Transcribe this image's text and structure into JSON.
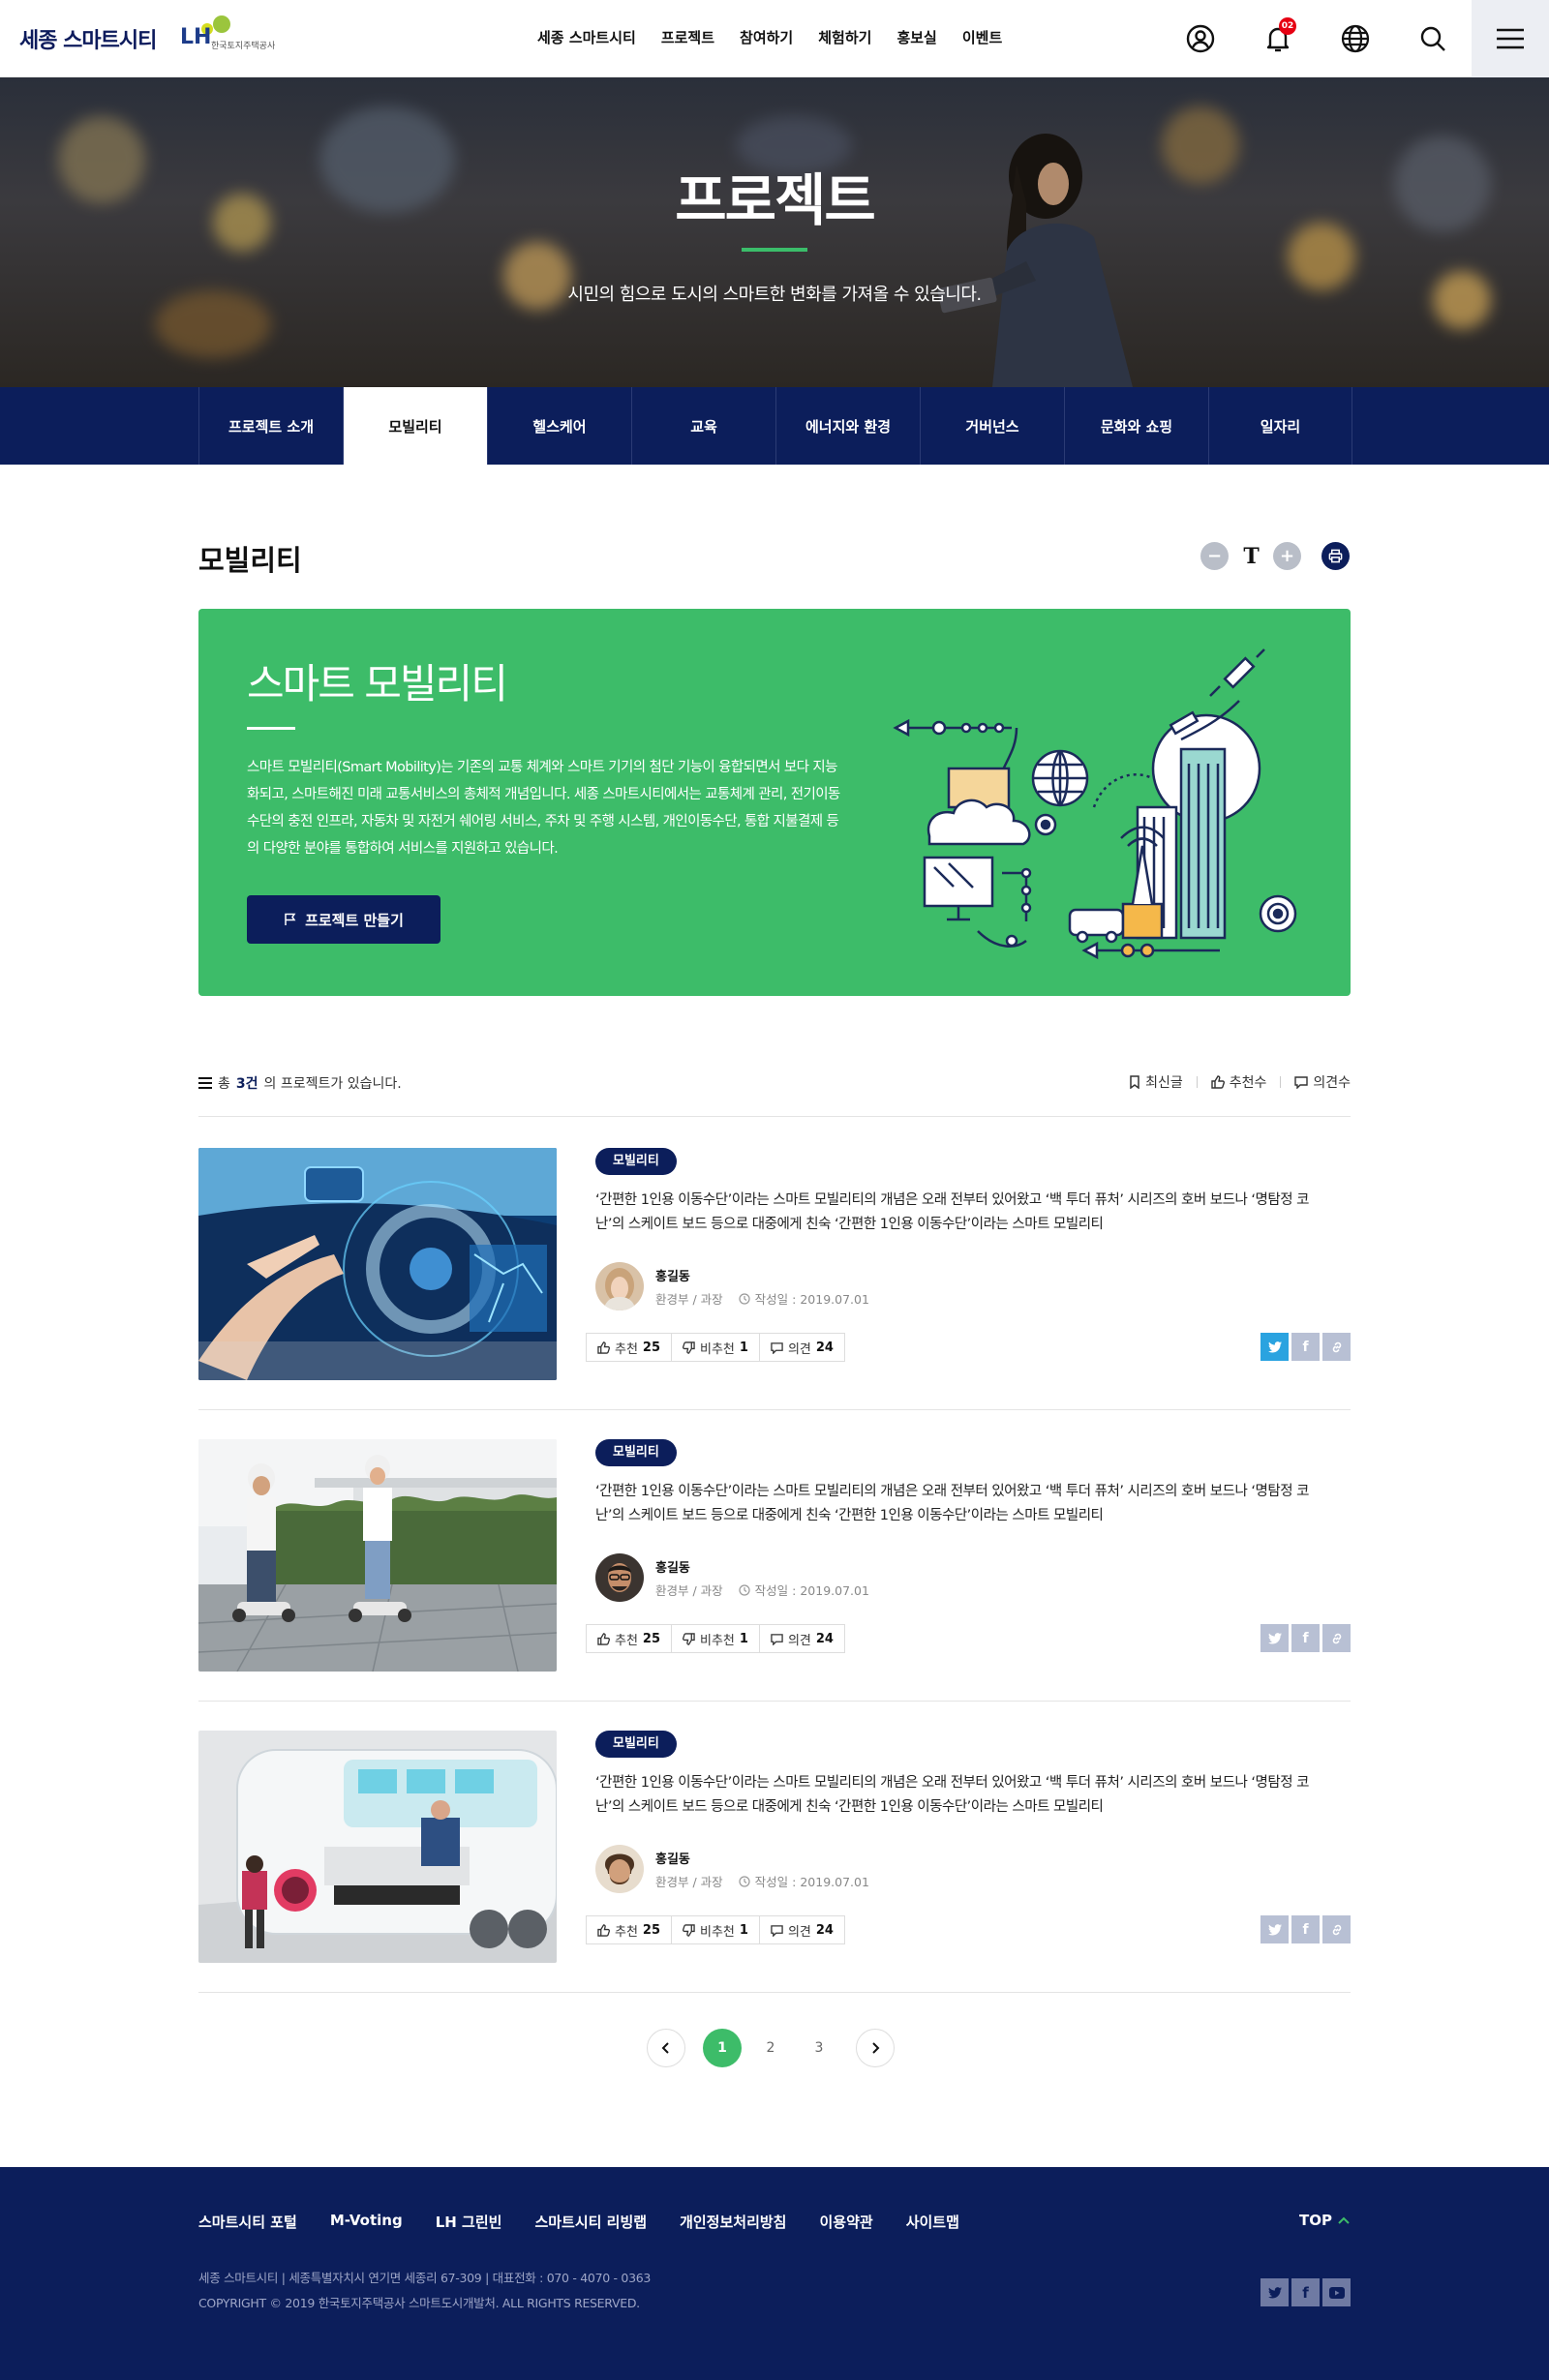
{
  "header": {
    "logo": "세종 스마트시티",
    "lh_logo": "LH",
    "lh_sub": "한국토지주택공사",
    "nav": [
      "세종 스마트시티",
      "프로젝트",
      "참여하기",
      "체험하기",
      "홍보실",
      "이벤트"
    ],
    "notification_count": "02",
    "icons": [
      "user-icon",
      "bell-icon",
      "globe-icon",
      "search-icon",
      "hamburger-menu-icon"
    ]
  },
  "hero": {
    "title": "프로젝트",
    "subtitle": "시민의 힘으로 도시의 스마트한 변화를 가져올 수 있습니다."
  },
  "tabs": [
    "프로젝트 소개",
    "모빌리티",
    "헬스케어",
    "교육",
    "에너지와 환경",
    "거버넌스",
    "문화와 쇼핑",
    "일자리"
  ],
  "active_tab": "모빌리티",
  "page": {
    "title": "모빌리티",
    "controls": {
      "zoom_out": "−",
      "font": "T",
      "zoom_in": "+"
    }
  },
  "intro": {
    "title": "스마트 모빌리티",
    "desc": "스마트 모빌리티(Smart Mobility)는 기존의 교통 체계와 스마트 기기의 첨단 기능이 융합되면서 보다 지능화되고, 스마트해진 미래 교통서비스의 총체적 개념입니다. 세종 스마트시티에서는 교통체계 관리, 전기이동수단의 충전 인프라, 자동차 및 자전거 쉐어링 서비스, 주차 및 주행 시스템, 개인이동수단, 통합 지불결제 등의 다양한 분야를 통합하여 서비스를 지원하고 있습니다.",
    "button": "프로젝트 만들기"
  },
  "list": {
    "count_prefix": "총",
    "count": "3건",
    "count_suffix": "의 프로젝트가 있습니다.",
    "sorts": [
      "최신글",
      "추천수",
      "의견수"
    ]
  },
  "projects": [
    {
      "category": "모빌리티",
      "desc": "‘간편한 1인용 이동수단’이라는 스마트 모빌리티의 개념은 오래 전부터 있어왔고 ‘백 투더 퓨처’ 시리즈의 호버 보드나 ‘명탐정 코난’의 스케이트 보드 등으로 대중에게 친숙 ‘간편한 1인용 이동수단’이라는 스마트 모빌리티",
      "author": "홍길동",
      "dept": "환경부 / 과장",
      "date": "작성일 : 2019.07.01",
      "like_label": "추천",
      "like": "25",
      "dislike_label": "비추천",
      "dislike": "1",
      "comment_label": "의견",
      "comment": "24",
      "share_active": true
    },
    {
      "category": "모빌리티",
      "desc": "‘간편한 1인용 이동수단’이라는 스마트 모빌리티의 개념은 오래 전부터 있어왔고 ‘백 투더 퓨처’ 시리즈의 호버 보드나 ‘명탐정 코난’의 스케이트 보드 등으로 대중에게 친숙 ‘간편한 1인용 이동수단’이라는 스마트 모빌리티",
      "author": "홍길동",
      "dept": "환경부 / 과장",
      "date": "작성일 : 2019.07.01",
      "like_label": "추천",
      "like": "25",
      "dislike_label": "비추천",
      "dislike": "1",
      "comment_label": "의견",
      "comment": "24",
      "share_active": false
    },
    {
      "category": "모빌리티",
      "desc": "‘간편한 1인용 이동수단’이라는 스마트 모빌리티의 개념은 오래 전부터 있어왔고 ‘백 투더 퓨처’ 시리즈의 호버 보드나 ‘명탐정 코난’의 스케이트 보드 등으로 대중에게 친숙 ‘간편한 1인용 이동수단’이라는 스마트 모빌리티",
      "author": "홍길동",
      "dept": "환경부 / 과장",
      "date": "작성일 : 2019.07.01",
      "like_label": "추천",
      "like": "25",
      "dislike_label": "비추천",
      "dislike": "1",
      "comment_label": "의견",
      "comment": "24",
      "share_active": false
    }
  ],
  "pagination": {
    "pages": [
      "1",
      "2",
      "3"
    ],
    "current": "1"
  },
  "footer": {
    "nav": [
      "스마트시티 포털",
      "M-Voting",
      "LH 그린빈",
      "스마트시티 리빙랩",
      "개인정보처리방침",
      "이용약관",
      "사이트맵"
    ],
    "top": "TOP",
    "address": "세종 스마트시티 | 세종특별자치시 연기면 세종리 67-309 | 대표전화 : 070 - 4070 - 0363",
    "copyright": "COPYRIGHT © 2019 한국토지주택공사 스마트도시개발처. ALL RIGHTS RESERVED."
  },
  "colors": {
    "navy": "#0c1e5b",
    "green": "#3dbc69",
    "twitter": "#2aa3e0",
    "notification": "#e60012"
  }
}
